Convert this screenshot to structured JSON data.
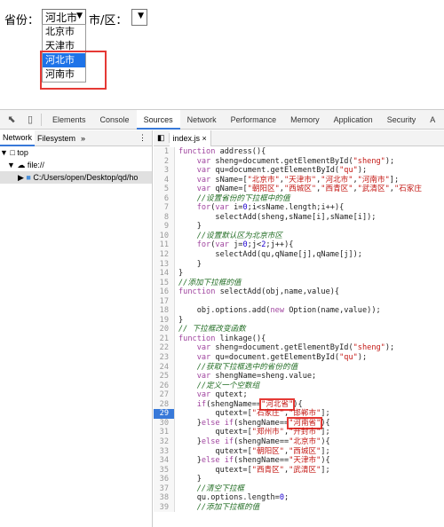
{
  "page": {
    "province_label": "省份：",
    "province_selected": "河北市",
    "city_label": "市/区：",
    "city_selected": "",
    "dropdown_options": [
      "北京市",
      "天津市",
      "河北市",
      "河南市"
    ],
    "highlighted_option": "河北市"
  },
  "devtools": {
    "tabs": [
      "Elements",
      "Console",
      "Sources",
      "Network",
      "Performance",
      "Memory",
      "Application",
      "Security",
      "A"
    ],
    "active_tab": "Sources",
    "left_tabs": [
      "Network",
      "Filesystem",
      "»"
    ],
    "tree": [
      "top",
      "file://",
      "C:/Users/open/Desktop/qd/ho"
    ],
    "file_tab": "index.js ×",
    "current_line": 29
  },
  "colors": {
    "accent": "#3879d9",
    "highlight": "#1e73e8",
    "annotation": "#e53935",
    "keyword": "#a0449f",
    "string": "#c41a16",
    "comment": "#236e25"
  }
}
